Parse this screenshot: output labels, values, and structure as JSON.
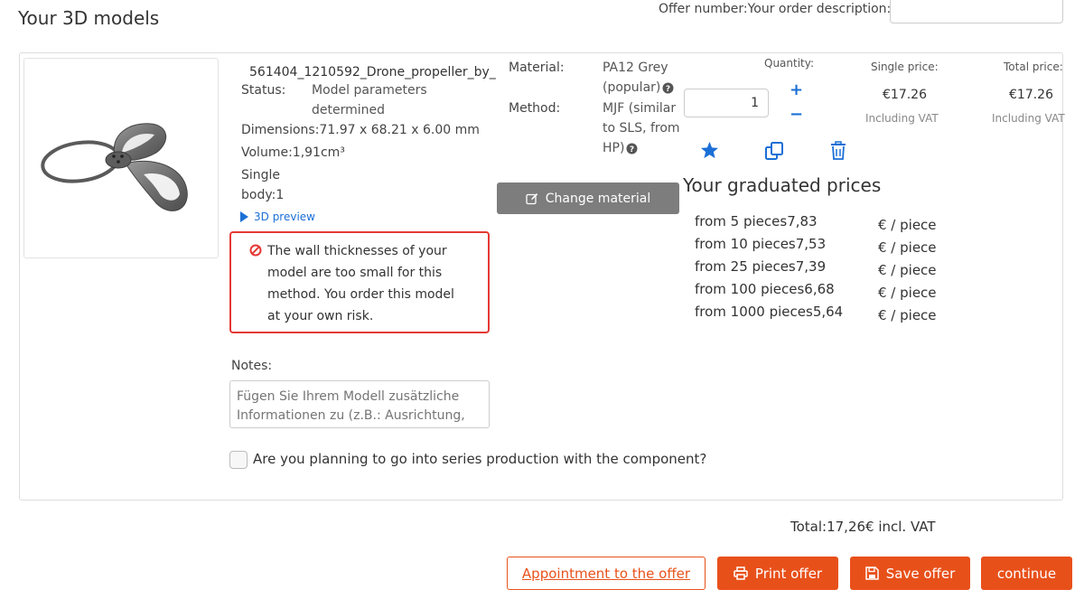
{
  "header": {
    "title": "Your 3D models",
    "offer_label": "Offer number:Your order description:"
  },
  "model": {
    "file_name": "561404_1210592_Drone_propeller_by_",
    "status_label": "Status:",
    "status_value_1": "Model parameters",
    "status_value_2": "determined",
    "dimensions": "Dimensions:71.97 x 68.21 x 6.00 mm",
    "volume": "Volume:1,91cm³",
    "single_body_1": "Single",
    "single_body_2": "body:1",
    "preview_label": "3D preview"
  },
  "warning": {
    "lines": [
      "The wall thicknesses of your",
      "model are too small for this",
      "method. You order this model",
      "at your own risk."
    ]
  },
  "notes": {
    "label": "Notes:",
    "placeholder": "Fügen Sie Ihrem Modell zusätzliche Informationen zu (z.B.: Ausrichtung, Sichtseiten, Flächen, kritische Maße etc.)"
  },
  "series": {
    "label": "Are you planning to go into series production with the component?",
    "checked": false
  },
  "material": {
    "material_label": "Material:",
    "material_value_1": "PA12 Grey",
    "material_value_2": "(popular)",
    "method_label": "Method:",
    "method_value_1": "MJF (similar",
    "method_value_2": "to SLS, from",
    "method_value_3": "HP)",
    "change_button": "Change material"
  },
  "order": {
    "quantity_label": "Quantity:",
    "quantity_value": "1",
    "single_price_label": "Single price:",
    "single_price": "€17.26",
    "total_price_label": "Total price:",
    "total_price": "€17.26",
    "vat_note": "Including VAT"
  },
  "graduated": {
    "title": "Your graduated prices",
    "unit": "€ / piece",
    "rows": [
      "from 5 pieces7,83",
      "from 10 pieces7,53",
      "from 25 pieces7,39",
      "from 100 pieces6,68",
      "from 1000 pieces5,64"
    ]
  },
  "footer": {
    "total": "Total:17,26€ incl. VAT",
    "appointment_button": "Appointment to the offer",
    "print_button": "Print offer",
    "save_button": "Save offer",
    "continue_button": "continue"
  },
  "colors": {
    "accent_orange": "#e8501a",
    "link_blue": "#1a6fd6",
    "warning_red": "#e53935",
    "button_grey": "#7d7d7d"
  },
  "icons": {
    "help": "question-circle-icon",
    "favorite": "star-icon",
    "duplicate": "copy-icon",
    "delete": "trash-icon",
    "warning": "ban-icon",
    "edit": "edit-icon",
    "print": "printer-icon",
    "save": "floppy-disk-icon"
  }
}
